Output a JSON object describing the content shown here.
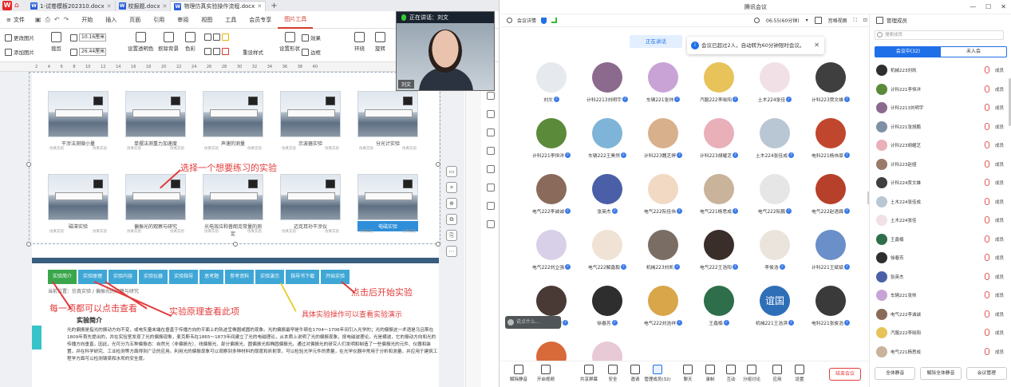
{
  "wps": {
    "tabs": [
      {
        "label": "1-试卷模板202310.docx",
        "active": false
      },
      {
        "label": "校报题.docx",
        "active": false
      },
      {
        "label": "物理仿真实验操作流程.docx",
        "active": true
      }
    ],
    "file_label": "文件",
    "ribbon_tabs": [
      "开始",
      "插入",
      "页面",
      "引用",
      "审阅",
      "视图",
      "工具",
      "会员专享",
      "图片工具"
    ],
    "active_ribbon_tab": "图片工具",
    "ribbon": {
      "change_image": "更改图片",
      "add_image": "添加图片",
      "crop": "裁剪",
      "width_value": "10.16厘米",
      "height_value": "26.44厘米",
      "transparent": "设置透明色",
      "remove_bg": "抠除背景",
      "color": "色彩",
      "effect": "效果",
      "border": "边框",
      "reset_style": "重设样式",
      "set_shape": "设置形状",
      "wrap": "环绕",
      "rotate": "旋转"
    },
    "ruler_marks": [
      "2",
      "4",
      "6",
      "8",
      "10",
      "12",
      "14",
      "16",
      "18",
      "20",
      "22",
      "24",
      "26",
      "28",
      "30",
      "32",
      "34",
      "36",
      "38",
      "40"
    ],
    "thumbnails_row1": [
      "干涉法测微小量",
      "单摆法测重力加速度",
      "声速的测量",
      "示波器实验",
      "分光计实验"
    ],
    "thumbnails_row2": [
      "磁滞实验",
      "偏振光的观察与研究",
      "光电效应和普朗克常量的测定",
      "迈克耳孙干涉仪",
      "电磁实验"
    ],
    "thumb_meta_left": "仿真实验",
    "thumb_meta_right": "仿真实验",
    "annotations": {
      "choose": "选择一个想要练习的实验",
      "each_click": "每一项都可以点击查看",
      "principle": "实验原理查看此项",
      "operation": "具体实验操作可以查看实验演示",
      "start": "点击后开始实验"
    },
    "nav_buttons": [
      "实验简介",
      "实验原理",
      "实验内容",
      "实验仪器",
      "实验指导",
      "思考题",
      "参考资料",
      "实验演示",
      "指导书下载",
      "开始实验"
    ],
    "breadcrumb": "当前位置：仿真实验 / 偏振光的观察与研究",
    "intro_title": "实验简介",
    "intro_text": "光的偏振是指光的振动方向不变，或电矢量末端在垂直于传播方向的平面上的轨迹呈椭圆或圆的现象。光的偏振最早是牛顿在1704～1706年间引入光学的；光的偏振这一术语是马吕斯在1809年首先提出的，并在实验室发现了光的偏振现象，麦克斯韦在1865～1873年间建立了光的电磁理论，从本质上说明了光的偏振现象，按电磁波理论，光是横波，它的振动方向和光的传播方向垂直，因此，光可分为五种偏振态：自然光（非偏振光）、线偏振光、部分偏振光、圆偏振光和椭圆偏振光。通过对偏振光的研究人们发明和制造了一些偏振光的元件、仪器和装置，并在科学研究、工业检测等方面得到广泛的应用。利用光的偏振现象可以观察到多种材料的厚度和折射率，可以检验光学元件的质量，在光学仪器中常用于分析和测量，并应用于建筑工程学方面可以检测钢梁和水坝的安全度。",
    "video": {
      "status": "正在讲话：刘文",
      "name": "刘文"
    }
  },
  "meeting": {
    "title": "腾讯会议",
    "details_label": "会议详情",
    "timer": "06:55(60分钟)",
    "view_label": "宫格视图",
    "speaking_label": "正在讲话",
    "toast_text": "会议已超过2人，自动转为60分钟限时会议。",
    "participants": [
      {
        "name": "刘文",
        "bg": "#e6e9ee"
      },
      {
        "name": "计科2213刘明宇",
        "bg": "#8b6a8e"
      },
      {
        "name": "车辆221张帅",
        "bg": "#c9a3d6"
      },
      {
        "name": "汽服222李晓阳",
        "bg": "#e7c35a"
      },
      {
        "name": "土木224张佳",
        "bg": "#f1e0e6"
      },
      {
        "name": "计科223贾文雄",
        "bg": "#3f3f3f"
      },
      {
        "name": "计科221李恒洋",
        "bg": "#5b8a3a"
      },
      {
        "name": "车辆222王昊然",
        "bg": "#7fb4d9"
      },
      {
        "name": "计科223魏芝婷",
        "bg": "#d9b08c"
      },
      {
        "name": "计科223胡耀芝",
        "bg": "#e9b0b9"
      },
      {
        "name": "土木224张佳成",
        "bg": "#b9c6d4"
      },
      {
        "name": "电科221杨伟豪",
        "bg": "#c1462e"
      },
      {
        "name": "电气222李诚诚",
        "bg": "#8a6a5a"
      },
      {
        "name": "张英杰",
        "bg": "#4a5fa8"
      },
      {
        "name": "电气222阮佳伟",
        "bg": "#f2d9c4"
      },
      {
        "name": "电气221杨思成",
        "bg": "#c9b39a"
      },
      {
        "name": "电气222阮鹏",
        "bg": "#e6e6e6"
      },
      {
        "name": "电气222赵语霖",
        "bg": "#b6402a"
      },
      {
        "name": "电气222刘立强",
        "bg": "#d8d0e8"
      },
      {
        "name": "电气222解鑫毅",
        "bg": "#f0e3d6"
      },
      {
        "name": "机械223刘凯",
        "bg": "#7a6e64"
      },
      {
        "name": "电气222王浩阳",
        "bg": "#3a2e2a"
      },
      {
        "name": "李俊浩",
        "bg": "#ebe4dc"
      },
      {
        "name": "计科221王斌斌",
        "bg": "#6a8fc9"
      },
      {
        "name": "电气222柳煜",
        "bg": "#4a3a36"
      },
      {
        "name": "徐春芳",
        "bg": "#2e2e2e"
      },
      {
        "name": "电气222刘浩祥",
        "bg": "#d9a64a"
      },
      {
        "name": "王鑫楠",
        "bg": "#2f6e4a"
      },
      {
        "name": "机械221王浩淇",
        "bg": "#2f6fb8"
      },
      {
        "name": "电科221张俊浩",
        "bg": "#3a3a3a"
      },
      {
        "name": "",
        "bg": "#d86a3a"
      },
      {
        "name": "",
        "bg": "#e8c9d6"
      }
    ],
    "avatar_text_yi": "谊国",
    "chat_placeholder": "说点什么…",
    "toolbar": [
      "解除静音",
      "开启视频",
      "共享屏幕",
      "安全",
      "邀请",
      "管理成员(32)",
      "聊天",
      "录制",
      "互动",
      "分组讨论",
      "应用",
      "设置"
    ],
    "end_label": "结束会议",
    "panel": {
      "title": "管理成员",
      "search_placeholder": "搜索成员",
      "tab_in": "会议中(32)",
      "tab_out": "未入会",
      "members": [
        "机械223刘凯",
        "计科221李恒洋",
        "计科2213刘明宇",
        "计科221张旭鹏",
        "计科223胡耀芝",
        "计科223赵娅",
        "计科224贾文雄",
        "土木224张佳成",
        "土木224张佳",
        "王鑫楠",
        "徐春芳",
        "张英杰",
        "车辆221张帅",
        "电气222李诚诚",
        "汽服222李晓阳",
        "电气221杨思成"
      ],
      "member_label": "成员",
      "mute_all": "全体静音",
      "unmute_all": "解除全体静音",
      "manage": "会议管理"
    }
  }
}
